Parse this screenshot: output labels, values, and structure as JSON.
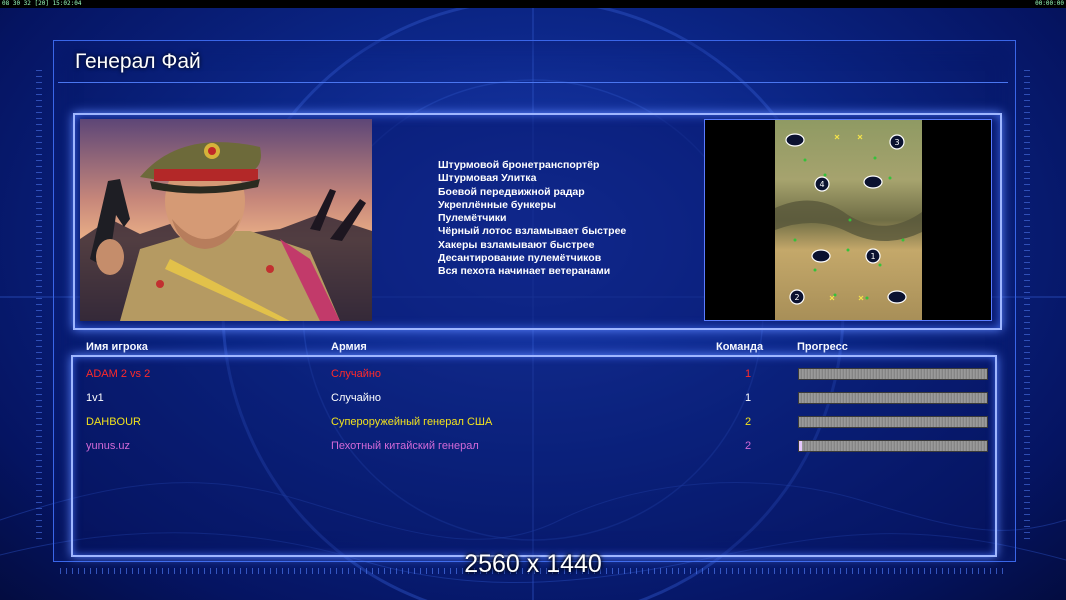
{
  "topbar": {
    "left": "08 30 32 [20] 15:02:04",
    "right": "00:00:00"
  },
  "general": {
    "title": "Генерал Фай"
  },
  "perks": [
    "Штурмовой бронетранспортёр",
    "Штурмовая Улитка",
    "Боевой передвижной радар",
    "Укреплённые бункеры",
    "Пулемётчики",
    "Чёрный лотос взламывает быстрее",
    "Хакеры взламывают быстрее",
    "Десантирование пулемётчиков",
    "Вся пехота начинает ветеранами"
  ],
  "minimap": {
    "start_positions": [
      "1",
      "2",
      "3",
      "4"
    ]
  },
  "table": {
    "headers": {
      "name": "Имя игрока",
      "army": "Армия",
      "team": "Команда",
      "progress": "Прогресс"
    },
    "rows": [
      {
        "name": "ADAM 2 vs 2",
        "army": "Случайно",
        "team": "1",
        "color": "#ff2a2a",
        "progress": 0
      },
      {
        "name": "1v1",
        "army": "Случайно",
        "team": "1",
        "color": "#ffffff",
        "progress": 0
      },
      {
        "name": "DAHBOUR",
        "army": "Супероружейный генерал США",
        "team": "2",
        "color": "#f2e21d",
        "progress": 0
      },
      {
        "name": "yunus.uz",
        "army": "Пехотный китайский генерал",
        "team": "2",
        "color": "#d36ad8",
        "progress": 0.01
      }
    ]
  },
  "overlay": {
    "resolution": "2560 x 1440"
  }
}
